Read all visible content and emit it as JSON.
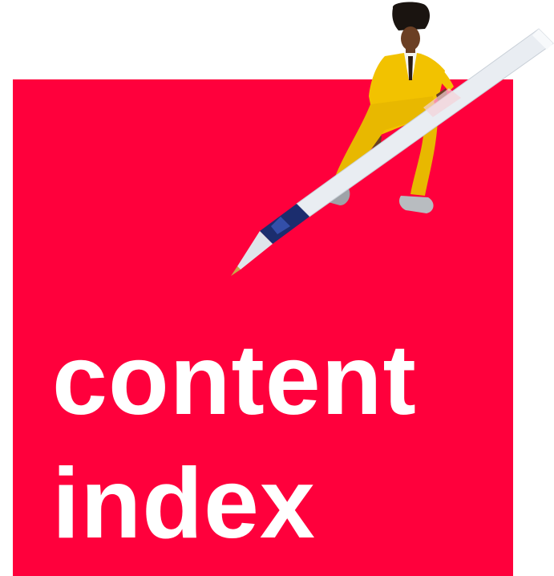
{
  "title": {
    "line1": "content",
    "line2": "index"
  },
  "colors": {
    "panel_red": "#ff003c",
    "title_text": "#ffffff",
    "suit_yellow": "#f2c200",
    "pen_body": "#e9edf2",
    "pen_grip": "#1b2d6e"
  },
  "illustration": {
    "subject": "woman-in-yellow-suit-pushing-giant-pen-icon"
  }
}
